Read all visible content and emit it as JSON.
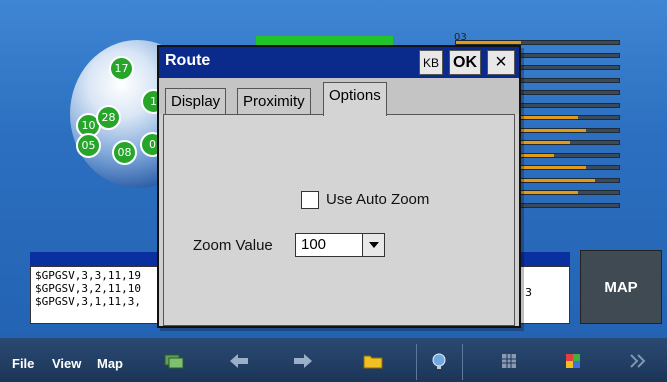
{
  "app": {
    "bar_label": "03",
    "satellites": [
      "17",
      "1",
      "10",
      "28",
      "05",
      "08",
      "0"
    ],
    "signal_levels": [
      0.4,
      0,
      0,
      0,
      0,
      0.25,
      0.75,
      0.8,
      0.7,
      0.6,
      0.8,
      0.85,
      0.75,
      0
    ]
  },
  "nmea": {
    "lines": [
      "$GPGSV,3,3,11,19",
      "$GPGSV,3,2,11,10",
      "$GPGSV,3,1,11,3,"
    ],
    "trailing_digit": "3"
  },
  "map_button": {
    "label": "MAP"
  },
  "toolbar": {
    "file": "File",
    "view": "View",
    "map": "Map"
  },
  "dialog": {
    "title": "Route",
    "kb_label": "KB",
    "ok_label": "OK",
    "close_label": "×",
    "tabs": [
      "Display",
      "Proximity",
      "Options"
    ],
    "active_tab": "Options",
    "use_auto_zoom_label": "Use Auto Zoom",
    "use_auto_zoom_checked": false,
    "zoom_value_label": "Zoom Value",
    "zoom_value": "100"
  },
  "colors": {
    "titlebar": "#0a2b8c",
    "satellite": "#27a52b",
    "signal_fill": "#e29a1a"
  }
}
